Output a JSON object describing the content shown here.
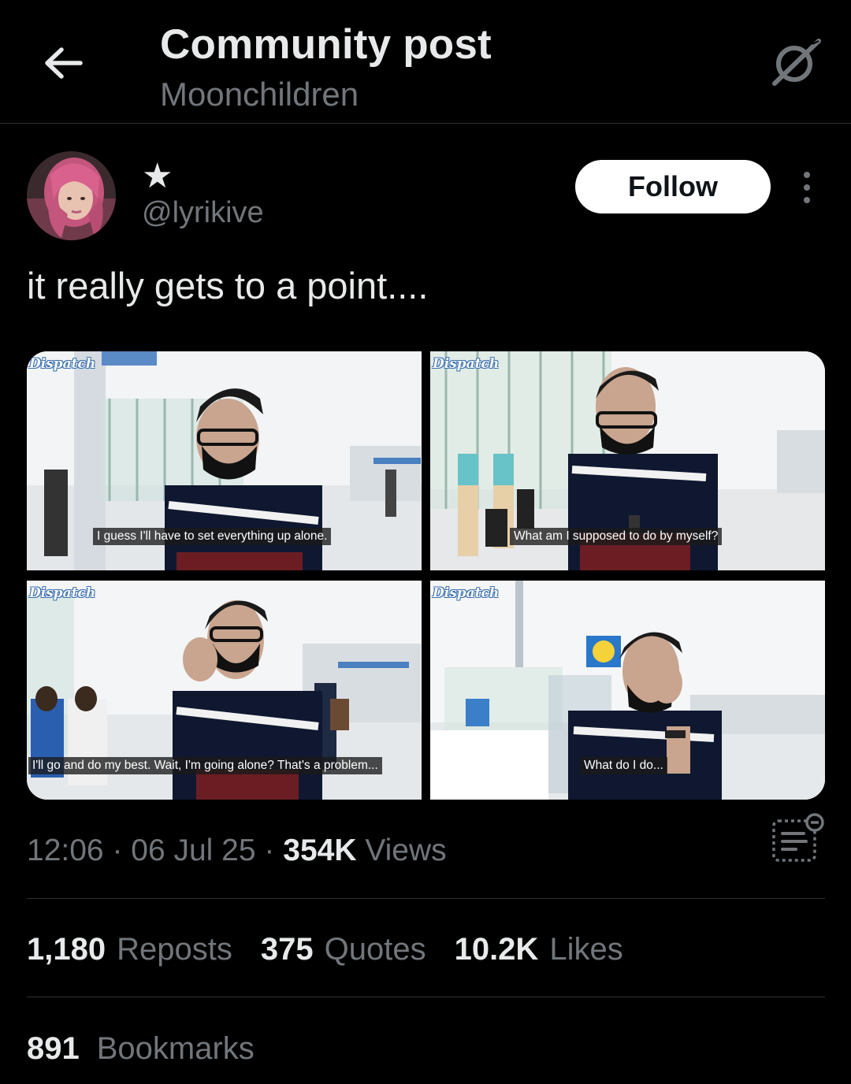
{
  "header": {
    "title": "Community post",
    "subtitle": "Moonchildren"
  },
  "author": {
    "display_name": "★",
    "handle": "@lyrikive"
  },
  "follow_label": "Follow",
  "post": {
    "text": "it really gets to a point...."
  },
  "media": [
    {
      "watermark": "Dispatch",
      "caption": "I guess I'll have to set everything up alone."
    },
    {
      "watermark": "Dispatch",
      "caption": "What am I supposed to do by myself?"
    },
    {
      "watermark": "Dispatch",
      "caption": "I'll go and do my best. Wait, I'm going alone? That's a problem..."
    },
    {
      "watermark": "Dispatch",
      "caption": "What do I do..."
    }
  ],
  "meta": {
    "time": "12:06",
    "date": "06 Jul 25",
    "views_count": "354K",
    "views_label": "Views"
  },
  "stats": {
    "reposts_count": "1,180",
    "reposts_label": "Reposts",
    "quotes_count": "375",
    "quotes_label": "Quotes",
    "likes_count": "10.2K",
    "likes_label": "Likes",
    "bookmarks_count": "891",
    "bookmarks_label": "Bookmarks"
  },
  "colors": {
    "background": "#000000",
    "primary_text": "#e7e9ea",
    "secondary_text": "#71767b",
    "divider": "#2f3336",
    "follow_bg": "#ffffff"
  },
  "icons": {
    "back": "arrow-left-icon",
    "grok": "grok-icon",
    "more": "more-vertical-icon",
    "analytics": "post-analytics-icon"
  }
}
